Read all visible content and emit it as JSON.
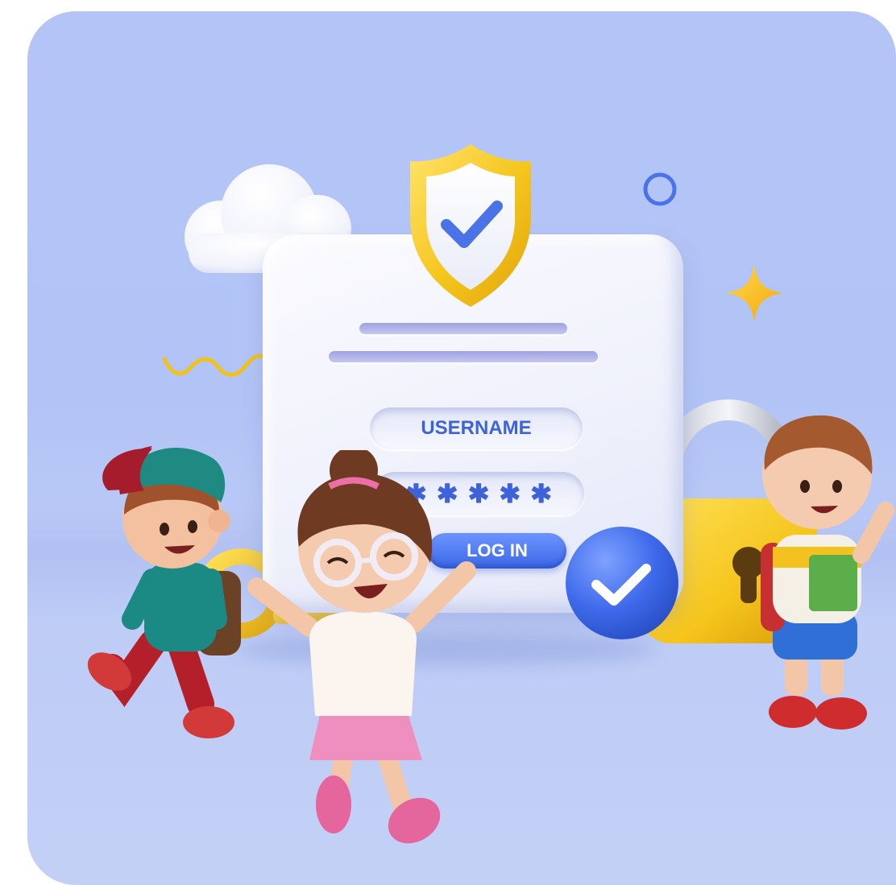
{
  "login_form": {
    "username_label": "USERNAME",
    "password_mask": "✱✱✱✱✱",
    "login_button_label": "LOG IN"
  },
  "colors": {
    "background": "#b4c4f6",
    "accent_blue": "#3c67e6",
    "shield_gold": "#f5c51c",
    "lock_gold": "#f2c21a",
    "card": "#f2f3fc"
  },
  "icons": [
    "shield-check-icon",
    "cloud-icon",
    "ring-icon",
    "sparkle-star-icon",
    "squiggle-icon",
    "padlock-icon",
    "check-badge-icon",
    "key-icon"
  ]
}
